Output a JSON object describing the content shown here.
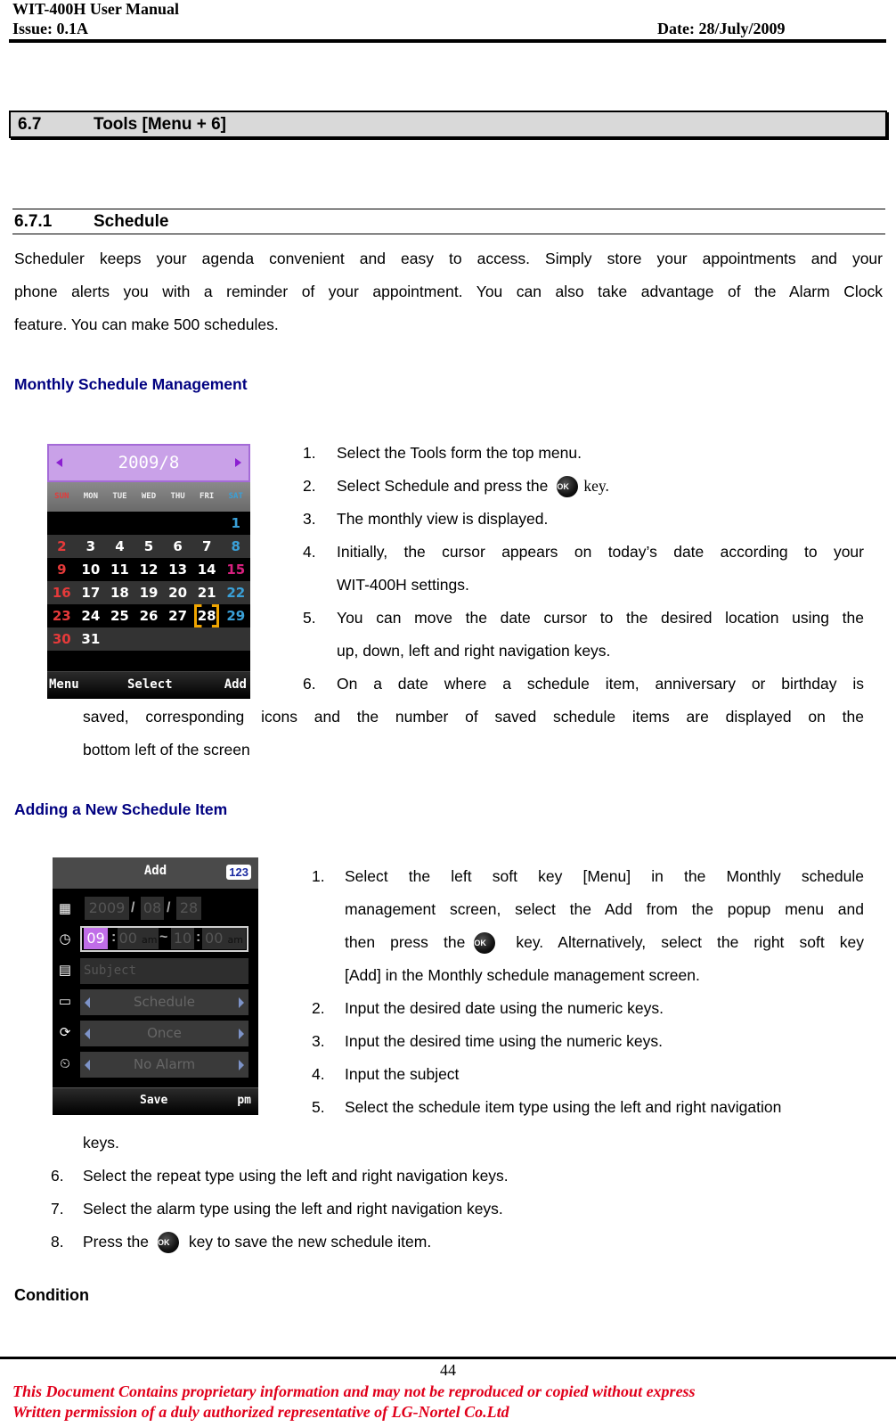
{
  "header": {
    "doc_title": "WIT-400H User Manual",
    "issue": "Issue: 0.1A",
    "date": "Date: 28/July/2009"
  },
  "section": {
    "number": "6.7",
    "title": "Tools [Menu + 6]"
  },
  "subsection": {
    "number": "6.7.1",
    "title": "Schedule"
  },
  "intro": {
    "lines": [
      "Scheduler keeps your agenda convenient and easy to access. Simply store your appointments and your",
      "phone alerts you with a reminder of your appointment. You can also take advantage of the Alarm Clock",
      "feature. You can make 500 schedules."
    ]
  },
  "monthly": {
    "heading": "Monthly Schedule Management",
    "steps": [
      {
        "n": "1.",
        "text": "Select the Tools form the top menu."
      },
      {
        "n": "2.",
        "text_before": "Select Schedule and press the",
        "key": "OK",
        "text_after": "key."
      },
      {
        "n": "3.",
        "text": "The monthly view is displayed."
      },
      {
        "n": "4.",
        "lines": [
          "Initially, the cursor appears on today’s date according to your",
          "WIT-400H settings."
        ]
      },
      {
        "n": "5.",
        "lines": [
          "You can move the date cursor to the desired location using the",
          "up, down, left and right navigation keys."
        ]
      },
      {
        "n": "6.",
        "lines": [
          "On a date where a schedule item, anniversary or birthday is",
          "saved, corresponding icons and the number of saved schedule items are displayed on the",
          "bottom left of the screen"
        ]
      }
    ],
    "screen": {
      "title": "2009/8",
      "weekdays": [
        "SUN",
        "MON",
        "TUE",
        "WED",
        "THU",
        "FRI",
        "SAT"
      ],
      "weeks": [
        [
          "",
          "",
          "",
          "",
          "",
          "",
          "1"
        ],
        [
          "2",
          "3",
          "4",
          "5",
          "6",
          "7",
          "8"
        ],
        [
          "9",
          "10",
          "11",
          "12",
          "13",
          "14",
          "15"
        ],
        [
          "16",
          "17",
          "18",
          "19",
          "20",
          "21",
          "22"
        ],
        [
          "23",
          "24",
          "25",
          "26",
          "27",
          "28",
          "29"
        ],
        [
          "30",
          "31",
          "",
          "",
          "",
          "",
          ""
        ]
      ],
      "selected_date": "28",
      "softkeys": {
        "left": "Menu",
        "center": "Select",
        "right": "Add"
      }
    }
  },
  "adding": {
    "heading": "Adding a New Schedule Item",
    "steps": [
      {
        "n": "1.",
        "lines": [
          "Select the left soft key [Menu] in the Monthly schedule",
          "management screen, select the Add from the popup menu and"
        ],
        "line3_before": "then press the",
        "key": "OK",
        "line3_after": "key. Alternatively, select the right soft key",
        "line4": "[Add] in the Monthly schedule management screen."
      },
      {
        "n": "2.",
        "text": "Input the desired date using the numeric keys."
      },
      {
        "n": "3.",
        "text": "Input the desired time using the numeric keys."
      },
      {
        "n": "4.",
        "text": "Input the subject"
      },
      {
        "n": "5.",
        "lines": [
          "Select the schedule item type using the left and right navigation",
          "keys."
        ]
      },
      {
        "n": "6.",
        "text": "Select the repeat type using the left and right navigation keys."
      },
      {
        "n": "7.",
        "text": "Select the alarm type using the left and right navigation keys."
      },
      {
        "n": "8.",
        "text_before": "Press the",
        "key": "OK",
        "text_after": "key to save the new schedule item."
      }
    ],
    "screen": {
      "title": "Add",
      "input_mode": "123",
      "date": {
        "year": "2009",
        "month": "08",
        "day": "28",
        "sep": "/"
      },
      "time": {
        "start_hour": "09",
        "start_min": "00",
        "start_ampm": "am",
        "range_sep": "~",
        "end_hour": "10",
        "end_min": "00",
        "end_ampm": "am",
        "colon": ":"
      },
      "subject_placeholder": "Subject",
      "type": "Schedule",
      "repeat": "Once",
      "alarm": "No Alarm",
      "softkeys": {
        "center": "Save",
        "right": "pm"
      }
    }
  },
  "condition_heading": "Condition",
  "footer": {
    "page_number": "44",
    "notice_line1": "This Document Contains proprietary information and may not be reproduced or copied without express",
    "notice_line2": "Written permission of a duly authorized representative of LG-Nortel Co.Ltd"
  }
}
